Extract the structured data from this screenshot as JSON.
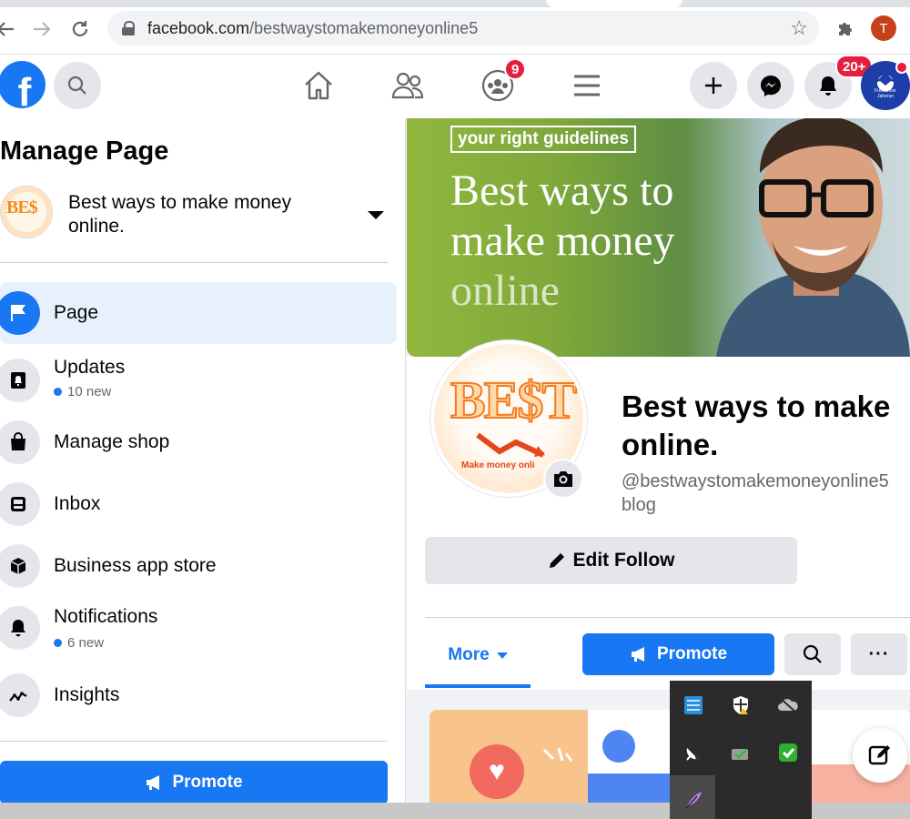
{
  "browser": {
    "url_host": "facebook.com",
    "url_path": "/bestwaystomakemoneyonline5",
    "profile_initial": "T"
  },
  "topbar": {
    "groups_badge": "9",
    "notifications_badge": "20+",
    "avatar_text_line1": "Freelancer",
    "avatar_text_line2": "Jaherun"
  },
  "sidebar": {
    "title": "Manage Page",
    "page_name": "Best ways to make money online.",
    "thumb_text": "BE$",
    "items": [
      {
        "label": "Page",
        "sub": ""
      },
      {
        "label": "Updates",
        "sub": "10 new"
      },
      {
        "label": "Manage shop",
        "sub": ""
      },
      {
        "label": "Inbox",
        "sub": ""
      },
      {
        "label": "Business app store",
        "sub": ""
      },
      {
        "label": "Notifications",
        "sub": "6 new"
      },
      {
        "label": "Insights",
        "sub": ""
      }
    ],
    "promote_label": "Promote"
  },
  "cover": {
    "tag": "your right guidelines",
    "line1": "Best ways to",
    "line2": "make money",
    "line3": "online"
  },
  "profile": {
    "pic_text": "BE$T",
    "pic_subtext": "Make money onli",
    "title_line1": "Best ways to make",
    "title_line2": "online.",
    "handle": "@bestwaystomakemoneyonline5",
    "category": "blog",
    "edit_follow_label": "Edit Follow",
    "more_tab_label": "More",
    "promote_label": "Promote",
    "more_dots": "···"
  },
  "colors": {
    "brand": "#1877f2",
    "badge": "#e41e3f"
  }
}
